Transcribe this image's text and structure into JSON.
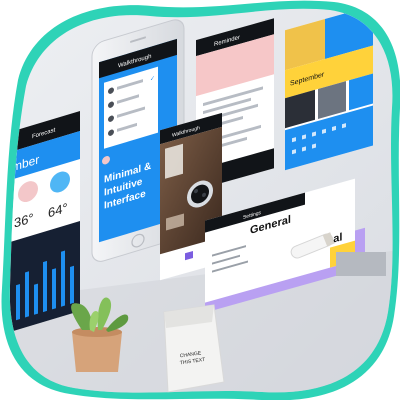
{
  "scene": {
    "phone_center": {
      "header_title": "Walkthrough",
      "headline_line1": "Minimal &",
      "headline_line2": "Intuitive",
      "headline_line3": "Interface"
    },
    "screen_weather": {
      "header_title": "Forecast",
      "month_label": "mber",
      "temp_left": "36°",
      "temp_right": "64°"
    },
    "screen_notes": {
      "header_title": "Reminder"
    },
    "screen_photo": {
      "header_title": "Walkthrough"
    },
    "screen_calendar": {
      "header_title": "September",
      "month_label": "September"
    },
    "screen_settings": {
      "header_title": "Settings",
      "section_1": "General",
      "section_2": "Personal"
    },
    "bag_label_line1": "CHANGE",
    "bag_label_line2": "THIS TEXT"
  },
  "colors": {
    "teal_frame": "#2ed3b7",
    "blue_accent": "#1e8ff0",
    "yellow_accent": "#ffd23a",
    "dark_header": "#111418",
    "phone_silver": "#e9ebee",
    "pink_card": "#f6c7c8",
    "purple_panel": "#b9a0f2"
  },
  "icons": [
    "check-icon",
    "circle-icon",
    "close-icon",
    "camera-icon"
  ]
}
